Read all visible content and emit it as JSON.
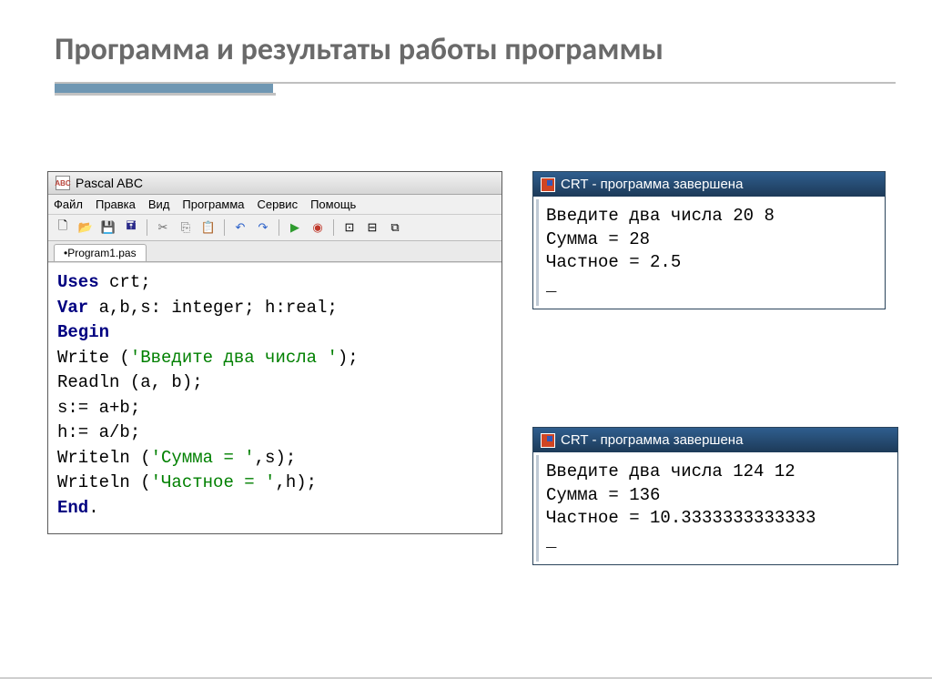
{
  "slide": {
    "title": "Программа и результаты работы программы"
  },
  "ide": {
    "icon_text": "ABC",
    "title": "Pascal ABC",
    "menus": [
      "Файл",
      "Правка",
      "Вид",
      "Программа",
      "Сервис",
      "Помощь"
    ],
    "tab": "•Program1.pas",
    "toolbar_icons": {
      "new": "🗋",
      "open": "📂",
      "save": "💾",
      "saveall": "🖬",
      "cut": "✂",
      "copy": "⎘",
      "paste": "📋",
      "undo": "↶",
      "redo": "↷",
      "run": "▶",
      "stop": "◉",
      "view1": "⊡",
      "view2": "⊟",
      "view3": "⧉"
    },
    "code": {
      "l1_kw": "Uses",
      "l1_rest": " crt;",
      "l2_kw": "Var",
      "l2_rest": " a,b,s: integer; h:real;",
      "l3_kw": "Begin",
      "l4_a": "Write (",
      "l4_str": "'Введите два числа '",
      "l4_b": ");",
      "l5": "Readln (a, b);",
      "l6": "s:= a+b;",
      "l7": "h:= a/b;",
      "l8_a": "Writeln (",
      "l8_str": "'Сумма = '",
      "l8_b": ",s);",
      "l9_a": "Writeln (",
      "l9_str": "'Частное = '",
      "l9_b": ",h);",
      "l10_kw": "End",
      "l10_rest": "."
    }
  },
  "crt1": {
    "title": "CRT - программа завершена",
    "l1": "Введите два числа 20 8",
    "l2": "Сумма = 28",
    "l3": "Частное = 2.5",
    "cursor": "_"
  },
  "crt2": {
    "title": "CRT - программа завершена",
    "l1": "Введите два числа 124 12",
    "l2": "Сумма = 136",
    "l3": "Частное = 10.3333333333333",
    "cursor": "_"
  }
}
